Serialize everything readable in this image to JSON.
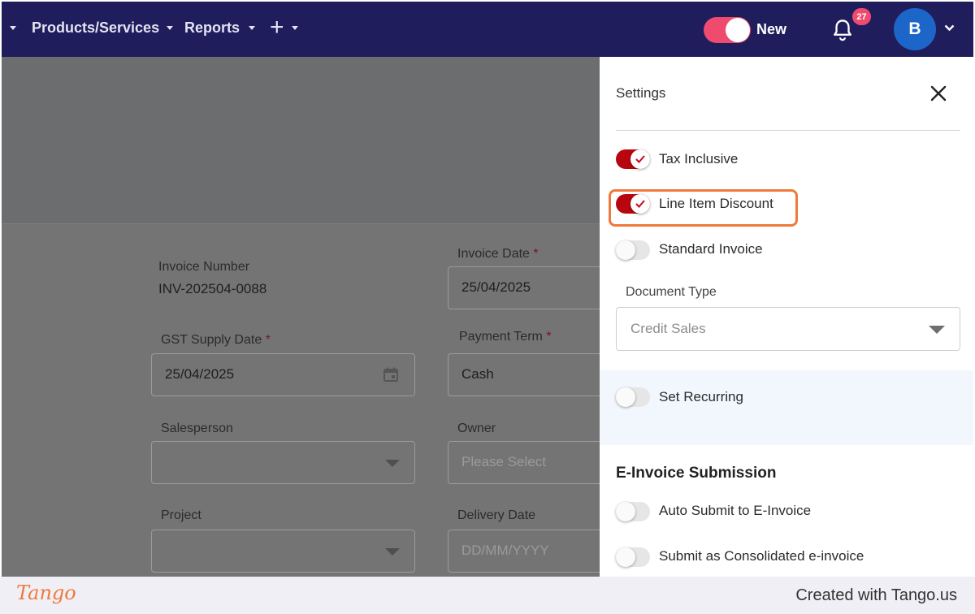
{
  "navbar": {
    "items": [
      {
        "label": "Products/Services"
      },
      {
        "label": "Reports"
      }
    ],
    "add_icon": "plus-icon",
    "new_toggle": {
      "label": "New",
      "on": true
    },
    "notifications": {
      "icon": "bell-icon",
      "count": "27"
    },
    "avatar": {
      "initial": "B"
    }
  },
  "form": {
    "invoice_number": {
      "label": "Invoice Number",
      "value": "INV-202504-0088"
    },
    "invoice_date": {
      "label": "Invoice Date",
      "required": "*",
      "value": "25/04/2025"
    },
    "gst_supply_date": {
      "label": "GST Supply Date",
      "required": "*",
      "value": "25/04/2025"
    },
    "payment_term": {
      "label": "Payment Term",
      "required": "*",
      "value": "Cash"
    },
    "salesperson": {
      "label": "Salesperson",
      "value": ""
    },
    "owner": {
      "label": "Owner",
      "placeholder": "Please Select"
    },
    "project": {
      "label": "Project",
      "value": ""
    },
    "delivery_date": {
      "label": "Delivery Date",
      "placeholder": "DD/MM/YYYY"
    }
  },
  "settings": {
    "title": "Settings",
    "toggles": [
      {
        "label": "Tax Inclusive",
        "on": true
      },
      {
        "label": "Line Item Discount",
        "on": true
      },
      {
        "label": "Standard Invoice",
        "on": false
      }
    ],
    "document_type": {
      "label": "Document Type",
      "value": "Credit Sales"
    },
    "set_recurring": {
      "label": "Set Recurring",
      "on": false
    },
    "einvoice": {
      "heading": "E-Invoice Submission",
      "toggles": [
        {
          "label": "Auto Submit to E-Invoice",
          "on": false
        },
        {
          "label": "Submit as Consolidated e-invoice",
          "on": false
        }
      ]
    }
  },
  "footer": {
    "logo": "Tango",
    "credit": "Created with Tango.us"
  },
  "colors": {
    "navbar": "#1f1d5c",
    "toggle_on": "#b8060e",
    "highlight": "#ef7a3c",
    "badge": "#ef4b6f",
    "avatar": "#1d66c9"
  }
}
